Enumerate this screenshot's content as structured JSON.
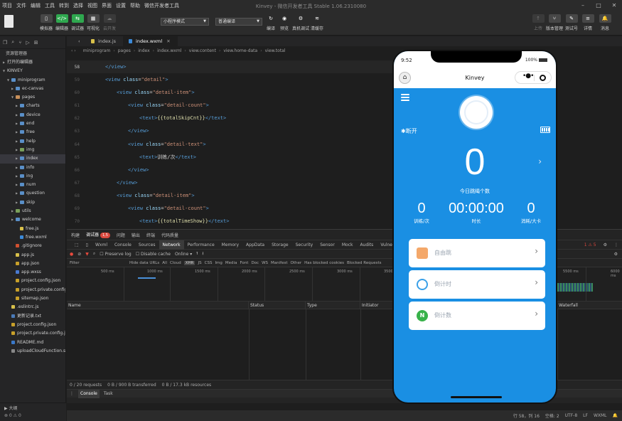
{
  "menubar": {
    "items": [
      "项目",
      "文件",
      "编辑",
      "工具",
      "转到",
      "选择",
      "视图",
      "界面",
      "设置",
      "帮助",
      "微信开发者工具"
    ],
    "title": "Kinvey - 微信开发者工具 Stable 1.06.2310080"
  },
  "toolbar": {
    "simulator": "模拟器",
    "editor": "编辑器",
    "debugger": "调试器",
    "visual": "可视化",
    "cloud": "云开发",
    "mode_select": "小程序模式",
    "compile_select": "普通编译",
    "compile": "编译",
    "preview": "预览",
    "remote_debug": "真机调试",
    "clear_cache": "清缓存",
    "upload": "上传",
    "version": "版本管理",
    "test": "测试号",
    "details": "详情",
    "messages": "消息"
  },
  "sidebar": {
    "title": "资源管理器",
    "open_editors": "打开的编辑器",
    "project": "KINVEY",
    "tree": [
      {
        "label": "miniprogram",
        "type": "folder",
        "depth": 1,
        "open": true
      },
      {
        "label": "ec-canvas",
        "type": "folder",
        "depth": 2
      },
      {
        "label": "pages",
        "type": "foldr",
        "depth": 2,
        "open": true
      },
      {
        "label": "charts",
        "type": "folder",
        "depth": 3
      },
      {
        "label": "device",
        "type": "folder",
        "depth": 3
      },
      {
        "label": "end",
        "type": "folder",
        "depth": 3
      },
      {
        "label": "free",
        "type": "folder",
        "depth": 3
      },
      {
        "label": "help",
        "type": "folder",
        "depth": 3
      },
      {
        "label": "img",
        "type": "foldg",
        "depth": 3
      },
      {
        "label": "index",
        "type": "folder",
        "depth": 3,
        "selected": true
      },
      {
        "label": "info",
        "type": "folder",
        "depth": 3
      },
      {
        "label": "ing",
        "type": "folder",
        "depth": 3
      },
      {
        "label": "num",
        "type": "folder",
        "depth": 3
      },
      {
        "label": "question",
        "type": "folder",
        "depth": 3
      },
      {
        "label": "skip",
        "type": "folder",
        "depth": 3
      },
      {
        "label": "utils",
        "type": "foldg",
        "depth": 2
      },
      {
        "label": "welcome",
        "type": "folder",
        "depth": 2
      },
      {
        "label": "free.js",
        "type": "js",
        "depth": 3
      },
      {
        "label": "free.wxml",
        "type": "wxml",
        "depth": 3
      },
      {
        "label": ".gitignore",
        "type": "git",
        "depth": 2
      },
      {
        "label": "app.js",
        "type": "js",
        "depth": 2
      },
      {
        "label": "app.json",
        "type": "json",
        "depth": 2
      },
      {
        "label": "app.wxss",
        "type": "wxss",
        "depth": 2
      },
      {
        "label": "project.config.json",
        "type": "json",
        "depth": 2
      },
      {
        "label": "project.private.config.j...",
        "type": "json",
        "depth": 2
      },
      {
        "label": "sitemap.json",
        "type": "json",
        "depth": 2
      },
      {
        "label": ".eslintrc.js",
        "type": "js",
        "depth": 1
      },
      {
        "label": "更新记录.txt",
        "type": "txt",
        "depth": 1
      },
      {
        "label": "project.config.json",
        "type": "json",
        "depth": 1
      },
      {
        "label": "project.private.config.js...",
        "type": "json",
        "depth": 1
      },
      {
        "label": "README.md",
        "type": "md",
        "depth": 1
      },
      {
        "label": "uploadCloudFunction.sh",
        "type": "sh",
        "depth": 1
      }
    ],
    "outline": "大纲",
    "counts": "⊗ 0 ⚠ 0"
  },
  "editor": {
    "tabs": [
      {
        "label": "index.js",
        "active": false
      },
      {
        "label": "index.wxml",
        "active": true
      }
    ],
    "breadcrumb": [
      "miniprogram",
      "pages",
      "index",
      "index.wxml",
      "view.content",
      "view.home-data",
      "view.total"
    ],
    "lines": [
      {
        "n": "58",
        "indent": 1,
        "html": "<span class='tag'>&lt;/view&gt;</span>"
      },
      {
        "n": "59",
        "indent": 1,
        "html": "<span class='tag'>&lt;view </span><span class='attr'>class</span><span class='tx'>=</span><span class='str'>\"detail\"</span><span class='tag'>&gt;</span>"
      },
      {
        "n": "60",
        "indent": 2,
        "html": "<span class='tag'>&lt;view </span><span class='attr'>class</span><span class='tx'>=</span><span class='str'>\"detail-item\"</span><span class='tag'>&gt;</span>"
      },
      {
        "n": "61",
        "indent": 3,
        "html": "<span class='tag'>&lt;view </span><span class='attr'>class</span><span class='tx'>=</span><span class='str'>\"detail-count\"</span><span class='tag'>&gt;</span>"
      },
      {
        "n": "62",
        "indent": 4,
        "html": "<span class='tag'>&lt;text&gt;</span><span class='mus'>{{totalSkipCnt}}</span><span class='tag'>&lt;/text&gt;</span>"
      },
      {
        "n": "63",
        "indent": 3,
        "html": "<span class='tag'>&lt;/view&gt;</span>"
      },
      {
        "n": "64",
        "indent": 3,
        "html": "<span class='tag'>&lt;view </span><span class='attr'>class</span><span class='tx'>=</span><span class='str'>\"detail-text\"</span><span class='tag'>&gt;</span>"
      },
      {
        "n": "65",
        "indent": 4,
        "html": "<span class='tag'>&lt;text&gt;</span><span class='tx'>训练/次</span><span class='tag'>&lt;/text&gt;</span>"
      },
      {
        "n": "66",
        "indent": 3,
        "html": "<span class='tag'>&lt;/view&gt;</span>"
      },
      {
        "n": "67",
        "indent": 2,
        "html": "<span class='tag'>&lt;/view&gt;</span>"
      },
      {
        "n": "68",
        "indent": 2,
        "html": "<span class='tag'>&lt;view </span><span class='attr'>class</span><span class='tx'>=</span><span class='str'>\"detail-item\"</span><span class='tag'>&gt;</span>"
      },
      {
        "n": "69",
        "indent": 3,
        "html": "<span class='tag'>&lt;view </span><span class='attr'>class</span><span class='tx'>=</span><span class='str'>\"detail-count\"</span><span class='tag'>&gt;</span>"
      },
      {
        "n": "70",
        "indent": 4,
        "html": "<span class='tag'>&lt;text&gt;</span><span class='mus'>{{totalTimeShow}}</span><span class='tag'>&lt;/text&gt;</span>"
      }
    ]
  },
  "devtools": {
    "top_tabs": [
      "构建",
      "调试器",
      "问题",
      "输出",
      "终端",
      "代码质量"
    ],
    "debugger_badge": "1,5",
    "panel_tabs": [
      "Wxml",
      "Console",
      "Sources",
      "Network",
      "Performance",
      "Memory",
      "AppData",
      "Storage",
      "Security",
      "Sensor",
      "Mock",
      "Audits",
      "Vulnerability"
    ],
    "active_panel": "Network",
    "issue_counts": "1  ⚠ 5",
    "preserve_log": "Preserve log",
    "disable_cache": "Disable cache",
    "throttle": "Online",
    "filter_label": "Filter",
    "filter_opts": [
      "Hide data URLs",
      "All",
      "Cloud",
      "XHR",
      "JS",
      "CSS",
      "Img",
      "Media",
      "Font",
      "Doc",
      "WS",
      "Manifest",
      "Other",
      "Has blocked cookies",
      "Blocked Requests"
    ],
    "ticks": [
      "500 ms",
      "1000 ms",
      "1500 ms",
      "2000 ms",
      "2500 ms",
      "3000 ms",
      "3500 ms",
      "5500 ms",
      "6000 ms"
    ],
    "columns": [
      "Name",
      "Status",
      "Type",
      "Initiator",
      "Waterfall"
    ],
    "summary": [
      "0 / 20 requests",
      "0 B / 900 B transferred",
      "0 B / 17.3 kB resources"
    ],
    "drawer_tabs": [
      "Console",
      "Task"
    ]
  },
  "statusbar": [
    "行 58，列 16",
    "空格: 2",
    "UTF-8",
    "LF",
    "WXML"
  ],
  "phone": {
    "time": "9:52",
    "battery": "100%",
    "nav_title": "Kinvey",
    "bt_status": "断开",
    "count": "0",
    "count_label": "今日跳绳个数",
    "stats": [
      {
        "value": "0",
        "label": "训练/次"
      },
      {
        "value": "00:00:00",
        "label": "时长"
      },
      {
        "value": "0",
        "label": "消耗/大卡"
      }
    ],
    "modes": [
      {
        "label": "自由跳",
        "icon": "rope-icon",
        "color": "#f0a060"
      },
      {
        "label": "倒计时",
        "icon": "timer-icon",
        "color": "#3aa0e8"
      },
      {
        "label": "倒计数",
        "icon": "counter-icon",
        "color": "#38b24a"
      }
    ],
    "accent": "#1a8fe3"
  }
}
